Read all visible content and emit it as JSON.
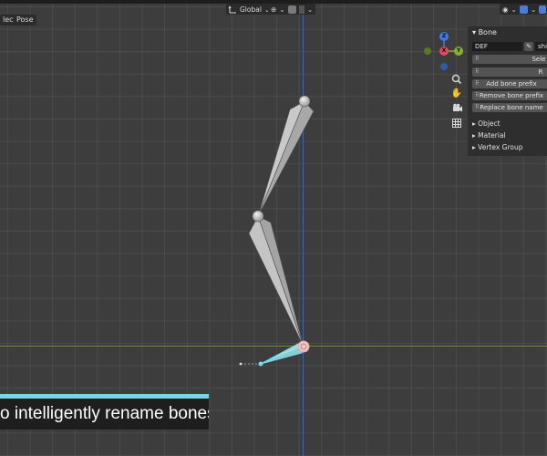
{
  "header": {
    "menu_select": "lect",
    "menu_pose": "Pose",
    "transform_orientation": "Global",
    "snap_glyph": "⊕",
    "shading_icon": "viewport-shading-icon"
  },
  "gizmo": {
    "x_label": "X",
    "y_label": "Y",
    "z_label": "Z",
    "colors": {
      "x": "#e04a5c",
      "y": "#88b02d",
      "z": "#3e7ce0"
    }
  },
  "nav_tools": [
    "zoom-icon",
    "hand-icon",
    "camera-icon",
    "grid-icon"
  ],
  "panel": {
    "header": "Bone",
    "prefix_field": "DEF",
    "name_field": "shin",
    "buttons": [
      "Sele",
      "R",
      "Add bone prefix",
      "Remove bone prefix",
      "Replace bone name"
    ],
    "subpanels": [
      "Object",
      "Material",
      "Vertex Group"
    ]
  },
  "caption": {
    "text": "o intelligently rename bones",
    "accent_color": "#73d9e5"
  }
}
